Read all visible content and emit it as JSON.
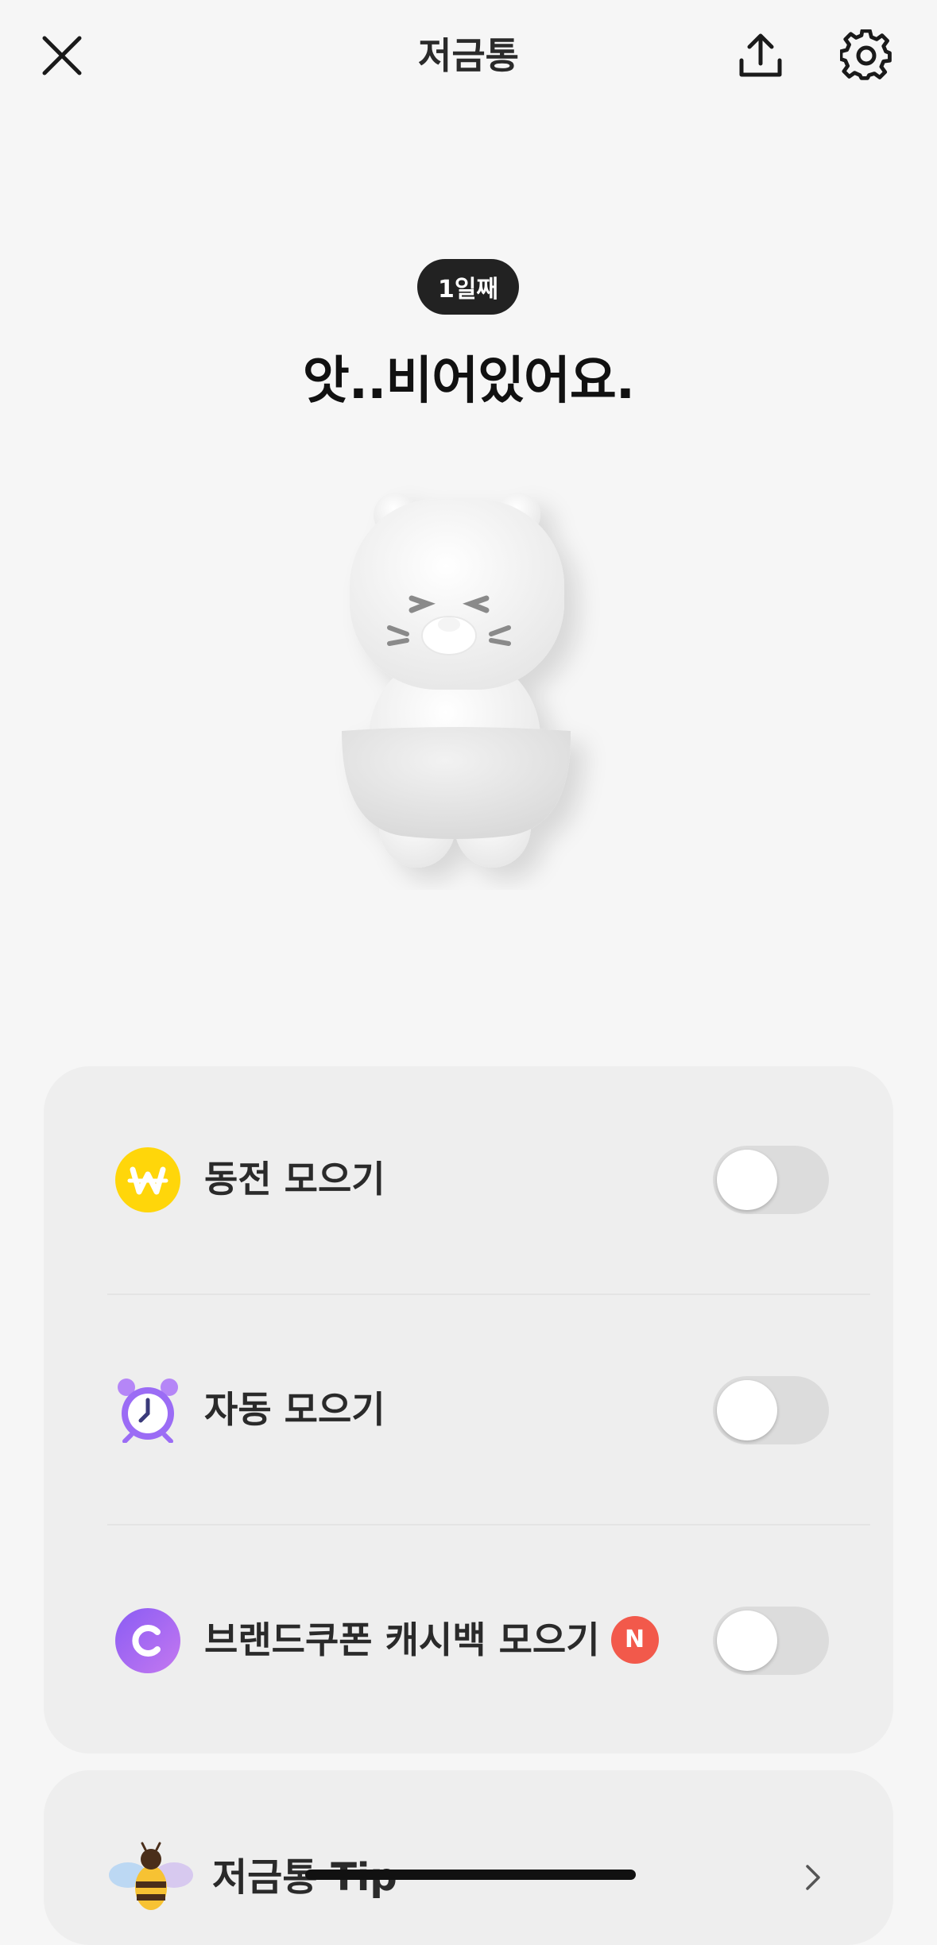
{
  "header": {
    "title": "저금통",
    "close_icon": "close-icon",
    "share_icon": "share-upload-icon",
    "settings_icon": "gear-icon"
  },
  "piggy": {
    "day_badge": "1일째",
    "status": "앗..비어있어요.",
    "character": "empty-bear-character"
  },
  "options": [
    {
      "icon": "won-coin-icon",
      "label": "동전 모으기",
      "enabled": false
    },
    {
      "icon": "alarm-clock-icon",
      "label": "자동 모으기",
      "enabled": false
    },
    {
      "icon": "cashback-c-icon",
      "label": "브랜드쿠폰 캐시백 모으기",
      "badge": "N",
      "enabled": false
    }
  ],
  "tip": {
    "icon": "bee-icon",
    "label": "저금통 Tip"
  },
  "colors": {
    "coin_yellow": "#ffd60a",
    "alarm_purple": "#9b6cf5",
    "cashback_purple": "#a36cf6",
    "new_badge": "#f2594b",
    "toggle_off": "#dcdcdc"
  }
}
